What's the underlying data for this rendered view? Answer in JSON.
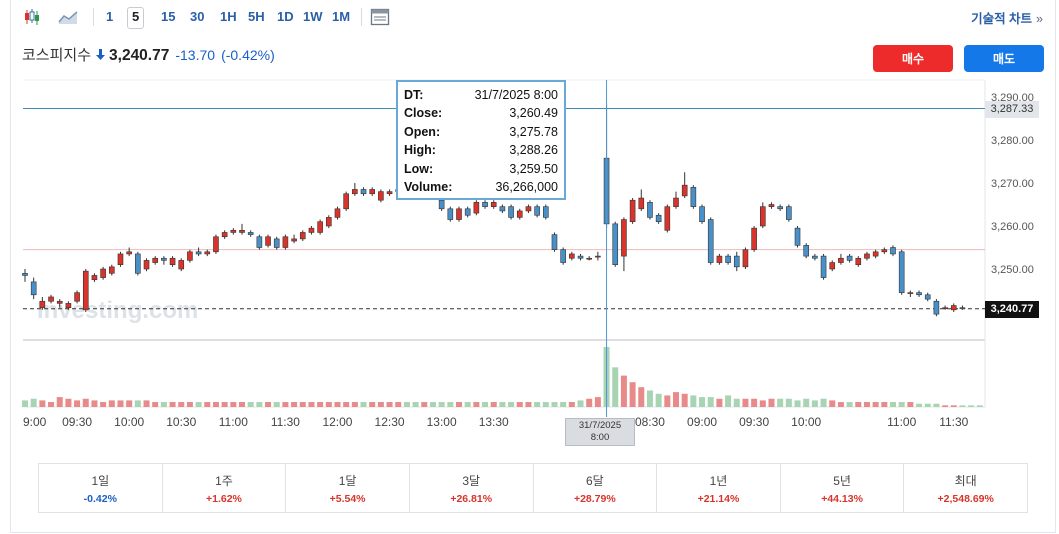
{
  "toolbar": {
    "chart_type_icons": [
      "candlestick-icon",
      "area-chart-icon"
    ],
    "timeframes": [
      "1",
      "5",
      "15",
      "30",
      "1H",
      "5H",
      "1D",
      "1W",
      "1M"
    ],
    "active_timeframe": "5",
    "table_icon": "table-icon",
    "advanced_label": "기술적 차트",
    "advanced_chevron": "»"
  },
  "quote": {
    "name": "코스피지수",
    "arrow": "🡇",
    "price": "3,240.77",
    "change": "-13.70",
    "change_pct": "(-0.42%)"
  },
  "buttons": {
    "buy": "매수",
    "sell": "매도"
  },
  "colors": {
    "up": "#d9342b",
    "down": "#4a90c8",
    "vol_up": "#e88a8a",
    "vol_down": "#a8d4b4",
    "accent": "#1a5fc8",
    "buy": "#ee2b2b",
    "sell": "#1478e8"
  },
  "watermark": "Investing.com",
  "tooltip": {
    "rows": [
      {
        "k": "DT:",
        "v": "31/7/2025 8:00"
      },
      {
        "k": "Close:",
        "v": "3,260.49"
      },
      {
        "k": "Open:",
        "v": "3,275.78"
      },
      {
        "k": "High:",
        "v": "3,288.26"
      },
      {
        "k": "Low:",
        "v": "3,259.50"
      },
      {
        "k": "Volume:",
        "v": "36,266,000"
      }
    ]
  },
  "crosshair_label": [
    "31/7/2025",
    "8:00"
  ],
  "price_tags": {
    "high_line": "3,287.33",
    "last": "3,240.77"
  },
  "performance": [
    {
      "label": "1일",
      "value": "-0.42%",
      "dir": "down"
    },
    {
      "label": "1주",
      "value": "+1.62%",
      "dir": "up"
    },
    {
      "label": "1달",
      "value": "+5.54%",
      "dir": "up"
    },
    {
      "label": "3달",
      "value": "+26.81%",
      "dir": "up"
    },
    {
      "label": "6달",
      "value": "+28.79%",
      "dir": "up"
    },
    {
      "label": "1년",
      "value": "+21.14%",
      "dir": "up"
    },
    {
      "label": "5년",
      "value": "+44.13%",
      "dir": "up"
    },
    {
      "label": "최대",
      "value": "+2,548.69%",
      "dir": "up"
    }
  ],
  "chart_data": {
    "type": "candlestick",
    "interval": "5 min",
    "y_ticks": [
      3250,
      3260,
      3270,
      3280,
      3290
    ],
    "y_tick_labels": [
      "3,250.00",
      "3,260.00",
      "3,270.00",
      "3,280.00",
      "3,290.00"
    ],
    "ylim": [
      3238,
      3294
    ],
    "reference_lines": {
      "high": 3287.33,
      "prev_close": 3254.5,
      "last": 3240.77
    },
    "x_tick_labels": [
      "9:00",
      "09:30",
      "10:00",
      "10:30",
      "11:00",
      "11:30",
      "12:00",
      "12:30",
      "13:00",
      "13:30",
      "08:30",
      "09:00",
      "09:30",
      "10:00",
      "11:00",
      "11:30"
    ],
    "x_tick_indices": [
      0,
      6,
      12,
      18,
      24,
      30,
      36,
      42,
      48,
      54,
      72,
      78,
      84,
      90,
      101,
      107
    ],
    "crosshair_index": 67,
    "candles": [
      {
        "o": 3249,
        "c": 3248.5,
        "h": 3250,
        "l": 3247
      },
      {
        "o": 3247,
        "c": 3244,
        "h": 3248,
        "l": 3243
      },
      {
        "o": 3241,
        "c": 3242.5,
        "h": 3243.5,
        "l": 3240.5
      },
      {
        "o": 3242.5,
        "c": 3243.5,
        "h": 3244,
        "l": 3242
      },
      {
        "o": 3242,
        "c": 3242.5,
        "h": 3243,
        "l": 3241
      },
      {
        "o": 3241,
        "c": 3242,
        "h": 3242.5,
        "l": 3240.5
      },
      {
        "o": 3242.5,
        "c": 3244.5,
        "h": 3245,
        "l": 3242
      },
      {
        "o": 3240.5,
        "c": 3249.5,
        "h": 3250,
        "l": 3240
      },
      {
        "o": 3247.5,
        "c": 3248.5,
        "h": 3249,
        "l": 3247
      },
      {
        "o": 3248,
        "c": 3250,
        "h": 3250.5,
        "l": 3247.5
      },
      {
        "o": 3249,
        "c": 3250.5,
        "h": 3251,
        "l": 3248.5
      },
      {
        "o": 3251,
        "c": 3253.5,
        "h": 3254,
        "l": 3250.5
      },
      {
        "o": 3253.5,
        "c": 3254,
        "h": 3255,
        "l": 3253
      },
      {
        "o": 3253.5,
        "c": 3249,
        "h": 3254,
        "l": 3248.5
      },
      {
        "o": 3250,
        "c": 3252,
        "h": 3252.5,
        "l": 3249.5
      },
      {
        "o": 3251.5,
        "c": 3252.5,
        "h": 3253,
        "l": 3251
      },
      {
        "o": 3252.5,
        "c": 3252,
        "h": 3253,
        "l": 3251
      },
      {
        "o": 3251,
        "c": 3252.5,
        "h": 3253,
        "l": 3250.5
      },
      {
        "o": 3250,
        "c": 3252,
        "h": 3252.5,
        "l": 3249.5
      },
      {
        "o": 3252,
        "c": 3254,
        "h": 3254.5,
        "l": 3251.5
      },
      {
        "o": 3254,
        "c": 3253.5,
        "h": 3255,
        "l": 3253
      },
      {
        "o": 3253.5,
        "c": 3254,
        "h": 3254.5,
        "l": 3253
      },
      {
        "o": 3254,
        "c": 3257.5,
        "h": 3258,
        "l": 3253.5
      },
      {
        "o": 3257.5,
        "c": 3258.5,
        "h": 3259,
        "l": 3257
      },
      {
        "o": 3258.5,
        "c": 3259,
        "h": 3259.5,
        "l": 3258
      },
      {
        "o": 3258.5,
        "c": 3259,
        "h": 3260.5,
        "l": 3258
      },
      {
        "o": 3258.5,
        "c": 3258,
        "h": 3259,
        "l": 3257.5
      },
      {
        "o": 3257.5,
        "c": 3255,
        "h": 3258,
        "l": 3254.5
      },
      {
        "o": 3255.5,
        "c": 3257.5,
        "h": 3258,
        "l": 3255
      },
      {
        "o": 3257,
        "c": 3255,
        "h": 3257.5,
        "l": 3254.5
      },
      {
        "o": 3255,
        "c": 3257.5,
        "h": 3258,
        "l": 3254.5
      },
      {
        "o": 3256.5,
        "c": 3257,
        "h": 3258,
        "l": 3256
      },
      {
        "o": 3257,
        "c": 3258.5,
        "h": 3259,
        "l": 3256.5
      },
      {
        "o": 3258.5,
        "c": 3259.5,
        "h": 3260,
        "l": 3258
      },
      {
        "o": 3258.5,
        "c": 3261,
        "h": 3261.5,
        "l": 3258
      },
      {
        "o": 3260,
        "c": 3262,
        "h": 3262.5,
        "l": 3259.5
      },
      {
        "o": 3262,
        "c": 3264,
        "h": 3264.5,
        "l": 3261.5
      },
      {
        "o": 3264,
        "c": 3267.5,
        "h": 3268,
        "l": 3263.5
      },
      {
        "o": 3267.5,
        "c": 3268.5,
        "h": 3270,
        "l": 3267
      },
      {
        "o": 3268.5,
        "c": 3267.5,
        "h": 3269,
        "l": 3267
      },
      {
        "o": 3267.5,
        "c": 3268.5,
        "h": 3269,
        "l": 3267
      },
      {
        "o": 3266,
        "c": 3268,
        "h": 3268.5,
        "l": 3265.5
      },
      {
        "o": 3267.5,
        "c": 3268,
        "h": 3268.5,
        "l": 3267
      },
      {
        "o": 3268,
        "c": 3268.5,
        "h": 3269.5,
        "l": 3267.5
      },
      {
        "o": 3268.5,
        "c": 3268,
        "h": 3269,
        "l": 3267.5
      },
      {
        "o": 3268,
        "c": 3267,
        "h": 3268.5,
        "l": 3266.5
      },
      {
        "o": 3267,
        "c": 3268,
        "h": 3268.5,
        "l": 3266.5
      },
      {
        "o": 3268,
        "c": 3267.5,
        "h": 3268.5,
        "l": 3267
      },
      {
        "o": 3266,
        "c": 3264,
        "h": 3266.5,
        "l": 3263.5
      },
      {
        "o": 3264,
        "c": 3261.5,
        "h": 3264.5,
        "l": 3261
      },
      {
        "o": 3261.5,
        "c": 3264,
        "h": 3264.5,
        "l": 3261
      },
      {
        "o": 3264,
        "c": 3262.5,
        "h": 3264.5,
        "l": 3262
      },
      {
        "o": 3263,
        "c": 3265.5,
        "h": 3266,
        "l": 3262.5
      },
      {
        "o": 3265.5,
        "c": 3264.5,
        "h": 3266,
        "l": 3264
      },
      {
        "o": 3264.5,
        "c": 3265.5,
        "h": 3266,
        "l": 3264
      },
      {
        "o": 3264.5,
        "c": 3263.5,
        "h": 3265,
        "l": 3263
      },
      {
        "o": 3264.5,
        "c": 3262,
        "h": 3265,
        "l": 3261.5
      },
      {
        "o": 3262,
        "c": 3263.5,
        "h": 3264,
        "l": 3261.5
      },
      {
        "o": 3263.5,
        "c": 3264.5,
        "h": 3265,
        "l": 3263
      },
      {
        "o": 3264.5,
        "c": 3262.5,
        "h": 3265,
        "l": 3262
      },
      {
        "o": 3264.5,
        "c": 3262,
        "h": 3265,
        "l": 3261.5
      },
      {
        "o": 3258,
        "c": 3254.5,
        "h": 3258.5,
        "l": 3254
      },
      {
        "o": 3254.5,
        "c": 3251.5,
        "h": 3255,
        "l": 3251
      },
      {
        "o": 3252.5,
        "c": 3253.5,
        "h": 3254,
        "l": 3252
      },
      {
        "o": 3253,
        "c": 3252.5,
        "h": 3253.5,
        "l": 3252
      },
      {
        "o": 3252.5,
        "c": 3252.5,
        "h": 3253,
        "l": 3252
      },
      {
        "o": 3253,
        "c": 3253,
        "h": 3254,
        "l": 3252
      },
      {
        "o": 3275.78,
        "c": 3260.49,
        "h": 3288.26,
        "l": 3259.5
      },
      {
        "o": 3260.5,
        "c": 3251,
        "h": 3261,
        "l": 3250.5
      },
      {
        "o": 3253,
        "c": 3261.5,
        "h": 3262,
        "l": 3249.5
      },
      {
        "o": 3261,
        "c": 3266,
        "h": 3266.5,
        "l": 3260.5
      },
      {
        "o": 3264,
        "c": 3266.5,
        "h": 3268.5,
        "l": 3263.5
      },
      {
        "o": 3265.5,
        "c": 3262,
        "h": 3266,
        "l": 3261.5
      },
      {
        "o": 3262.5,
        "c": 3261,
        "h": 3263,
        "l": 3260.5
      },
      {
        "o": 3259,
        "c": 3264.5,
        "h": 3265,
        "l": 3258.5
      },
      {
        "o": 3264.5,
        "c": 3266.5,
        "h": 3268,
        "l": 3264
      },
      {
        "o": 3267,
        "c": 3269.5,
        "h": 3272.5,
        "l": 3266.5
      },
      {
        "o": 3269,
        "c": 3264.5,
        "h": 3269.5,
        "l": 3264
      },
      {
        "o": 3264.5,
        "c": 3261,
        "h": 3265,
        "l": 3260.5
      },
      {
        "o": 3261.5,
        "c": 3251.5,
        "h": 3262,
        "l": 3251
      },
      {
        "o": 3251.5,
        "c": 3253,
        "h": 3253.5,
        "l": 3251
      },
      {
        "o": 3253,
        "c": 3251.5,
        "h": 3253.5,
        "l": 3251
      },
      {
        "o": 3253,
        "c": 3250.5,
        "h": 3254,
        "l": 3249.5
      },
      {
        "o": 3250.5,
        "c": 3254.5,
        "h": 3255,
        "l": 3250
      },
      {
        "o": 3254.5,
        "c": 3259.5,
        "h": 3260,
        "l": 3254
      },
      {
        "o": 3260,
        "c": 3264.5,
        "h": 3265.5,
        "l": 3259.5
      },
      {
        "o": 3264.5,
        "c": 3265,
        "h": 3265.5,
        "l": 3264
      },
      {
        "o": 3264.5,
        "c": 3264,
        "h": 3265,
        "l": 3263.5
      },
      {
        "o": 3264.5,
        "c": 3261.5,
        "h": 3265,
        "l": 3261
      },
      {
        "o": 3259.5,
        "c": 3255.5,
        "h": 3260,
        "l": 3255
      },
      {
        "o": 3255.5,
        "c": 3253,
        "h": 3256,
        "l": 3252.5
      },
      {
        "o": 3253,
        "c": 3252.5,
        "h": 3253.5,
        "l": 3252
      },
      {
        "o": 3253,
        "c": 3248,
        "h": 3253.5,
        "l": 3247.5
      },
      {
        "o": 3250,
        "c": 3251.5,
        "h": 3252,
        "l": 3249.5
      },
      {
        "o": 3251.5,
        "c": 3252.5,
        "h": 3253.5,
        "l": 3251
      },
      {
        "o": 3253,
        "c": 3252,
        "h": 3253.5,
        "l": 3251.5
      },
      {
        "o": 3251,
        "c": 3252.5,
        "h": 3253,
        "l": 3250.5
      },
      {
        "o": 3252.5,
        "c": 3253.5,
        "h": 3254,
        "l": 3252
      },
      {
        "o": 3253,
        "c": 3254,
        "h": 3254.5,
        "l": 3252.5
      },
      {
        "o": 3254,
        "c": 3254.5,
        "h": 3255,
        "l": 3253.5
      },
      {
        "o": 3255,
        "c": 3253.5,
        "h": 3255.5,
        "l": 3253
      },
      {
        "o": 3254,
        "c": 3244.5,
        "h": 3254.5,
        "l": 3244
      },
      {
        "o": 3244.5,
        "c": 3244.5,
        "h": 3245,
        "l": 3243.5
      },
      {
        "o": 3244.5,
        "c": 3244,
        "h": 3245,
        "l": 3243.5
      },
      {
        "o": 3244,
        "c": 3243,
        "h": 3244.5,
        "l": 3242.5
      },
      {
        "o": 3242.5,
        "c": 3239.5,
        "h": 3243,
        "l": 3239
      },
      {
        "o": 3241,
        "c": 3241,
        "h": 3241.5,
        "l": 3240.5
      },
      {
        "o": 3240.5,
        "c": 3241.5,
        "h": 3242,
        "l": 3240
      },
      {
        "o": 3241,
        "c": 3240.77,
        "h": 3241.5,
        "l": 3240.5
      }
    ],
    "volume": [
      4,
      5,
      4,
      3,
      6,
      5,
      4,
      5,
      4,
      3,
      4,
      4,
      4,
      4,
      4,
      3,
      3,
      3,
      3,
      3,
      3,
      3,
      3,
      3,
      3,
      3,
      3,
      3,
      3,
      3,
      3,
      3,
      3,
      3,
      3,
      3,
      3,
      3,
      3,
      3,
      3,
      3,
      3,
      3,
      3,
      3,
      3,
      3,
      3,
      3,
      3,
      3,
      3,
      3,
      3,
      3,
      3,
      3,
      3,
      3,
      3,
      3,
      3,
      3,
      4,
      5,
      6,
      36.3,
      24,
      19,
      15,
      12,
      10,
      8,
      7,
      9,
      8,
      7,
      6,
      6,
      5,
      7,
      5,
      5,
      5,
      4,
      5,
      5,
      5,
      4,
      5,
      4,
      5,
      4,
      3,
      3,
      3,
      3,
      3,
      3,
      3,
      3,
      3,
      2,
      2,
      2,
      1,
      1,
      1,
      1,
      1
    ]
  }
}
